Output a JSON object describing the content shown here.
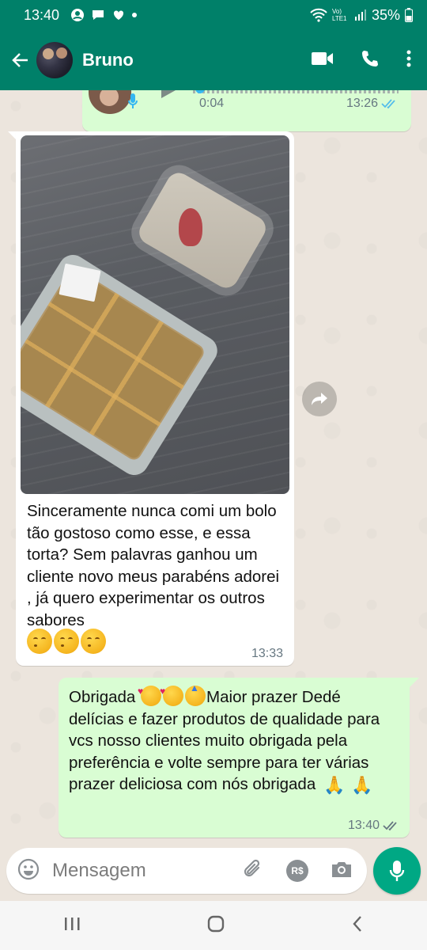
{
  "status_bar": {
    "time": "13:40",
    "network_label": "Vo) LTE1",
    "battery": "35%"
  },
  "header": {
    "contact_name": "Bruno",
    "icons": [
      "back-arrow-icon",
      "video-call-icon",
      "voice-call-icon",
      "more-options-icon"
    ]
  },
  "messages": {
    "audio": {
      "duration": "0:04",
      "time": "13:26"
    },
    "incoming": {
      "text": "Sinceramente nunca comi um bolo tão gostoso como esse, e essa torta? Sem palavras ganhou um cliente novo meus parabéns adorei , já quero experimentar os outros sabores",
      "emoji_count": 3,
      "time": "13:33"
    },
    "outgoing": {
      "word_start": "Obrigada",
      "text": "Maior prazer Dedé delícias e fazer produtos de qualidade para vcs nosso clientes muito obrigada pela preferência e volte sempre para ter várias prazer deliciosa com nós obrigada",
      "time": "13:40"
    }
  },
  "composer": {
    "placeholder": "Mensagem",
    "icons": [
      "emoji-icon",
      "attach-icon",
      "payment-icon",
      "camera-icon",
      "mic-icon"
    ],
    "payment_label": "R$"
  },
  "colors": {
    "header": "#008069",
    "chat_bg": "#ece5dd",
    "outgoing_bubble": "#d9fdd3",
    "accent": "#00a884",
    "read_ticks": "#53bdeb"
  }
}
